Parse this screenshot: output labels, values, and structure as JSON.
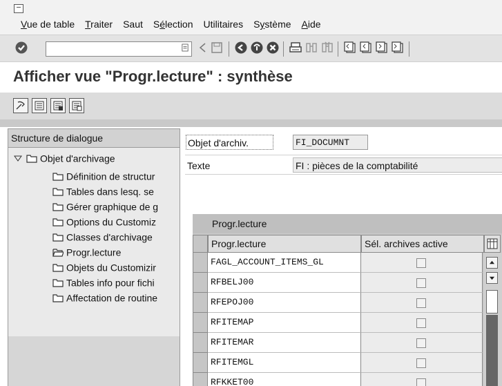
{
  "menubar": {
    "items": [
      {
        "label": "Vue de table",
        "ul": "V",
        "rest": "ue de table"
      },
      {
        "label": "Traiter",
        "ul": "T",
        "rest": "raiter"
      },
      {
        "label": "Saut",
        "ul": "",
        "rest": "Saut"
      },
      {
        "label": "Sélection",
        "ul": "é",
        "pre": "S",
        "rest": "lection"
      },
      {
        "label": "Utilitaires",
        "ul": "",
        "rest": "Utilitaires"
      },
      {
        "label": "Système",
        "ul": "y",
        "pre": "S",
        "rest": "stème"
      },
      {
        "label": "Aide",
        "ul": "A",
        "rest": "ide"
      }
    ]
  },
  "toolbar": {
    "command_field_value": "",
    "icons": [
      "enter-icon",
      "back-icon",
      "save-icon",
      "back-green-icon",
      "exit-icon",
      "cancel-icon",
      "print-icon",
      "find-icon",
      "find-next-icon",
      "first-page-icon",
      "prev-page-icon",
      "next-page-icon",
      "last-page-icon"
    ]
  },
  "title": "Afficher vue \"Progr.lecture\" : synthèse",
  "app_toolbar": {
    "icons": [
      "change-icon",
      "details-icon",
      "select-all-icon",
      "deselect-all-icon"
    ]
  },
  "tree": {
    "header": "Structure de dialogue",
    "root": "Objet d'archivage",
    "children": [
      "Définition de structur",
      "Tables dans lesq. se",
      "Gérer graphique de g",
      "Options du Customiz",
      "Classes d'archivage",
      "Progr.lecture",
      "Objets du Customizir",
      "Tables info pour fichi",
      "Affectation de routine"
    ],
    "selected": "Progr.lecture"
  },
  "fields": {
    "object_label": "Objet d'archiv.",
    "object_value": "FI_DOCUMNT",
    "text_label": "Texte",
    "text_value": "FI : pièces de la comptabilité"
  },
  "table": {
    "title": "Progr.lecture",
    "columns": [
      "Progr.lecture",
      "Sél. archives active"
    ],
    "rows": [
      {
        "prog": "FAGL_ACCOUNT_ITEMS_GL",
        "active": false
      },
      {
        "prog": "RFBELJ00",
        "active": false
      },
      {
        "prog": "RFEPOJ00",
        "active": false
      },
      {
        "prog": "RFITEMAP",
        "active": false
      },
      {
        "prog": "RFITEMAR",
        "active": false
      },
      {
        "prog": "RFITEMGL",
        "active": false
      },
      {
        "prog": "RFKKET00",
        "active": false
      }
    ]
  }
}
